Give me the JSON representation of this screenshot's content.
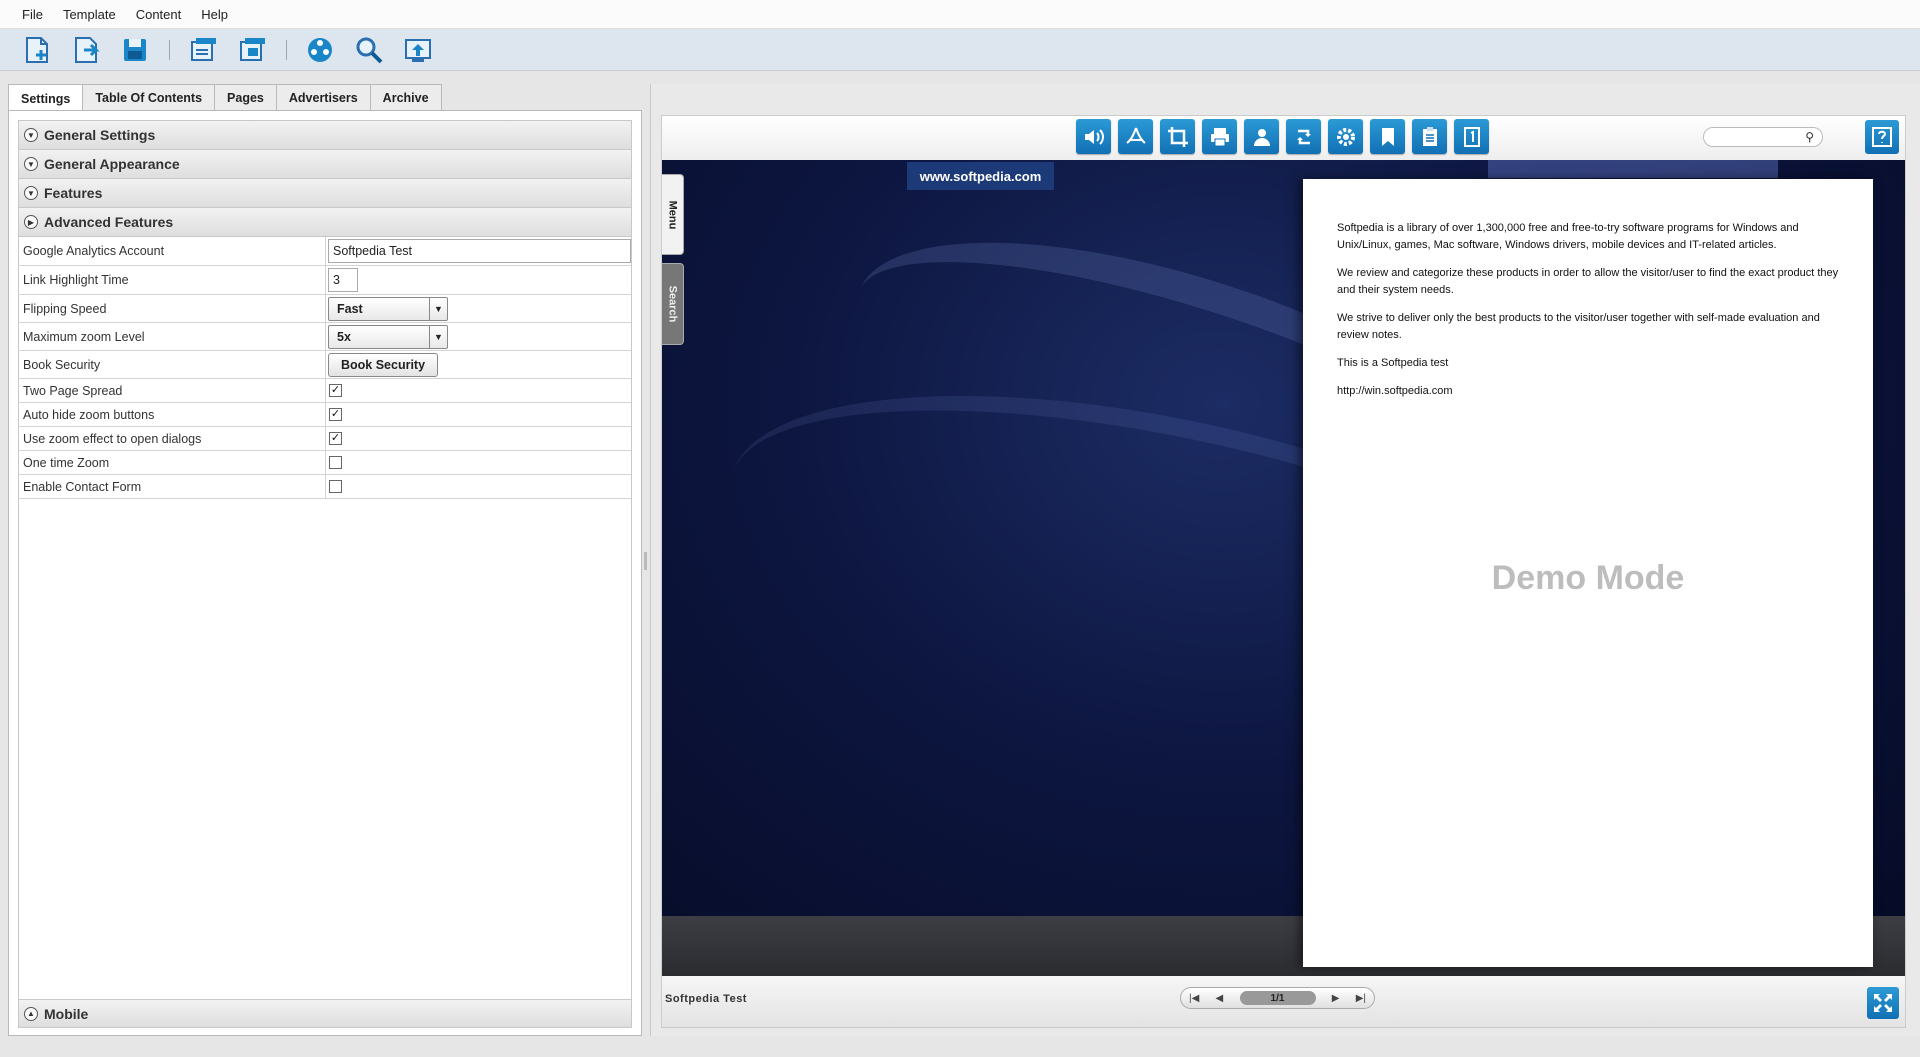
{
  "menu": [
    "File",
    "Template",
    "Content",
    "Help"
  ],
  "toolbar": {
    "icons": [
      "new-project-icon",
      "open-project-icon",
      "save-icon",
      "import-pages-icon",
      "export-pages-icon",
      "preview-book-icon",
      "zoom-preview-icon",
      "publish-icon"
    ]
  },
  "tabs": [
    "Settings",
    "Table Of Contents",
    "Pages",
    "Advertisers",
    "Archive"
  ],
  "sections": {
    "general_settings": "General Settings",
    "general_appearance": "General Appearance",
    "features": "Features",
    "advanced_features": "Advanced Features",
    "mobile": "Mobile"
  },
  "fields": {
    "google_analytics": {
      "label": "Google Analytics Account",
      "value": "Softpedia Test"
    },
    "link_highlight": {
      "label": "Link Highlight Time",
      "value": "3"
    },
    "flipping_speed": {
      "label": "Flipping Speed",
      "value": "Fast"
    },
    "max_zoom": {
      "label": "Maximum zoom Level",
      "value": "5x"
    },
    "book_security": {
      "label": "Book Security",
      "button": "Book Security"
    },
    "two_page_spread": {
      "label": "Two Page Spread",
      "checked": true
    },
    "auto_hide_zoom": {
      "label": "Auto hide zoom buttons",
      "checked": true
    },
    "zoom_effect": {
      "label": "Use zoom effect to open dialogs",
      "checked": true
    },
    "one_time_zoom": {
      "label": "One time Zoom",
      "checked": false
    },
    "contact_form": {
      "label": "Enable Contact Form",
      "checked": false
    }
  },
  "viewer": {
    "toolbar_icons": [
      "sound-icon",
      "pdf-icon",
      "crop-icon",
      "print-icon",
      "share-icon",
      "rotate-icon",
      "settings-icon",
      "bookmark-icon",
      "notes-icon",
      "single-page-icon"
    ],
    "side_tabs": [
      "Menu",
      "Search"
    ],
    "logo_text": "www.softpedia.com",
    "page_paragraphs": [
      "Softpedia is a library of over 1,300,000 free and free-to-try software programs for Windows and Unix/Linux, games, Mac software, Windows drivers, mobile devices and IT-related articles.",
      "We review and categorize these products in order to allow the visitor/user to find the exact product they and their system needs.",
      "We strive to deliver only the best products to the visitor/user together with self-made evaluation and review notes.",
      "This is a Softpedia test",
      "http://win.softpedia.com"
    ],
    "demo_text": "Demo Mode",
    "footer_title": "Softpedia Test",
    "page_indicator": "1/1"
  },
  "colors": {
    "accent": "#1a86c8",
    "toolbar_bg": "#dde6ee",
    "stage_dark": "#0d1640"
  }
}
